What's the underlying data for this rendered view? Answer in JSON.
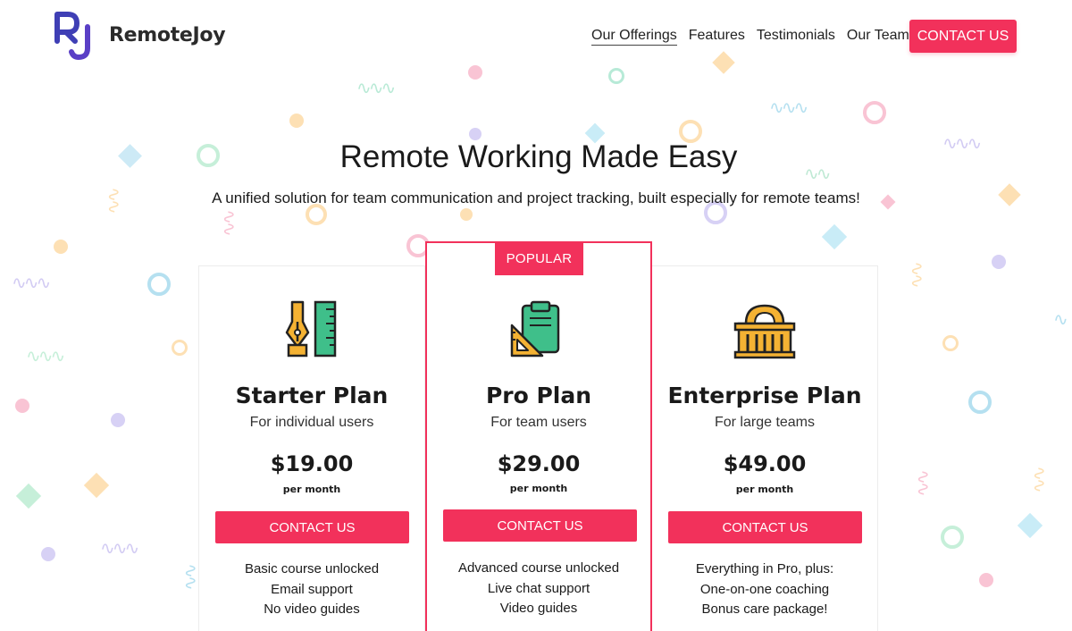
{
  "brand": {
    "logo_letters": "RJ",
    "name": "RemoteJoy",
    "logo_colors": {
      "r": "#3f3fb5",
      "j": "#5a3fc6"
    }
  },
  "nav": {
    "items": [
      {
        "label": "Our Offerings",
        "active": true
      },
      {
        "label": "Features",
        "active": false
      },
      {
        "label": "Testimonials",
        "active": false
      },
      {
        "label": "Our Team",
        "active": false
      }
    ],
    "cta_label": "CONTACT US"
  },
  "hero": {
    "title": "Remote Working Made Easy",
    "subtitle": "A unified solution for team communication and project tracking, built especially for remote teams!"
  },
  "plans": [
    {
      "name": "Starter Plan",
      "audience": "For individual users",
      "price": "$19.00",
      "period": "per month",
      "cta_label": "CONTACT US",
      "icon": "pen-ruler-icon",
      "features": [
        "Basic course unlocked",
        "Email support",
        "No video guides"
      ]
    },
    {
      "badge": "POPULAR",
      "name": "Pro Plan",
      "audience": "For team users",
      "price": "$29.00",
      "period": "per month",
      "cta_label": "CONTACT US",
      "icon": "clipboard-set-square-icon",
      "features": [
        "Advanced course unlocked",
        "Live chat support",
        "Video guides"
      ]
    },
    {
      "name": "Enterprise Plan",
      "audience": "For large teams",
      "price": "$49.00",
      "period": "per month",
      "cta_label": "CONTACT US",
      "icon": "building-dome-icon",
      "features": [
        "Everything in Pro, plus:",
        "One-on-one coaching",
        "Bonus care package!"
      ]
    }
  ],
  "colors": {
    "accent": "#f2315b",
    "text": "#1a1a1a",
    "confetti": [
      "#f7a8c0",
      "#a8e6cf",
      "#fcd39b",
      "#c9c3f2",
      "#a9dff0"
    ]
  }
}
